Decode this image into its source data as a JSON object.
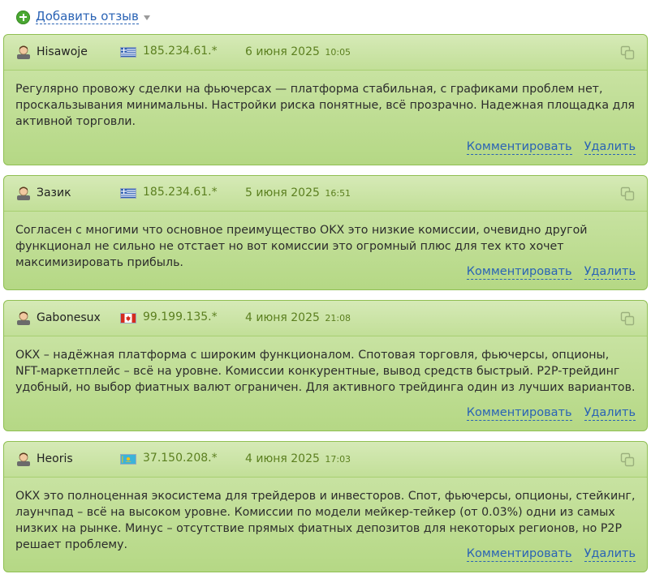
{
  "toolbar": {
    "add_review_label": "Добавить отзыв"
  },
  "reviews": [
    {
      "user": "Hisawoje",
      "flag": "greece",
      "ip": "185.234.61.*",
      "date": "6 июня 2025",
      "time": "10:05",
      "text": "Регулярно провожу сделки на фьючерсах — платформа стабильная, с графиками проблем нет, проскальзывания минимальны. Настройки риска понятные, всё прозрачно. Надежная площадка для активной торговли.",
      "comment_label": "Комментировать",
      "delete_label": "Удалить"
    },
    {
      "user": "Зазик",
      "flag": "greece",
      "ip": "185.234.61.*",
      "date": "5 июня 2025",
      "time": "16:51",
      "text": "Согласен с многими что основное преимущество OKX это низкие комиссии, очевидно другой функционал не сильно не отстает но вот комиссии это огромный плюс для тех кто хочет максимизировать прибыль.",
      "comment_label": "Комментировать",
      "delete_label": "Удалить"
    },
    {
      "user": "Gabonesux",
      "flag": "canada",
      "ip": "99.199.135.*",
      "date": "4 июня 2025",
      "time": "21:08",
      "text": "OKX – надёжная платформа с широким функционалом. Спотовая торговля, фьючерсы, опционы, NFT-маркетплейс – всё на уровне. Комиссии конкурентные, вывод средств быстрый. P2P-трейдинг удобный, но выбор фиатных валют ограничен. Для активного трейдинга один из лучших вариантов.",
      "comment_label": "Комментировать",
      "delete_label": "Удалить"
    },
    {
      "user": "Heoris",
      "flag": "kazakhstan",
      "ip": "37.150.208.*",
      "date": "4 июня 2025",
      "time": "17:03",
      "text": "OKX это полноценная экосистема для трейдеров и инвесторов. Спот, фьючерсы, опционы, стейкинг, лаунчпад – всё на высоком уровне. Комиссии по модели мейкер-тейкер (от 0.03%) одни из самых низких на рынке. Минус – отсутствие прямых фиатных депозитов для некоторых регионов, но P2P решает проблему.",
      "comment_label": "Комментировать",
      "delete_label": "Удалить"
    }
  ]
}
